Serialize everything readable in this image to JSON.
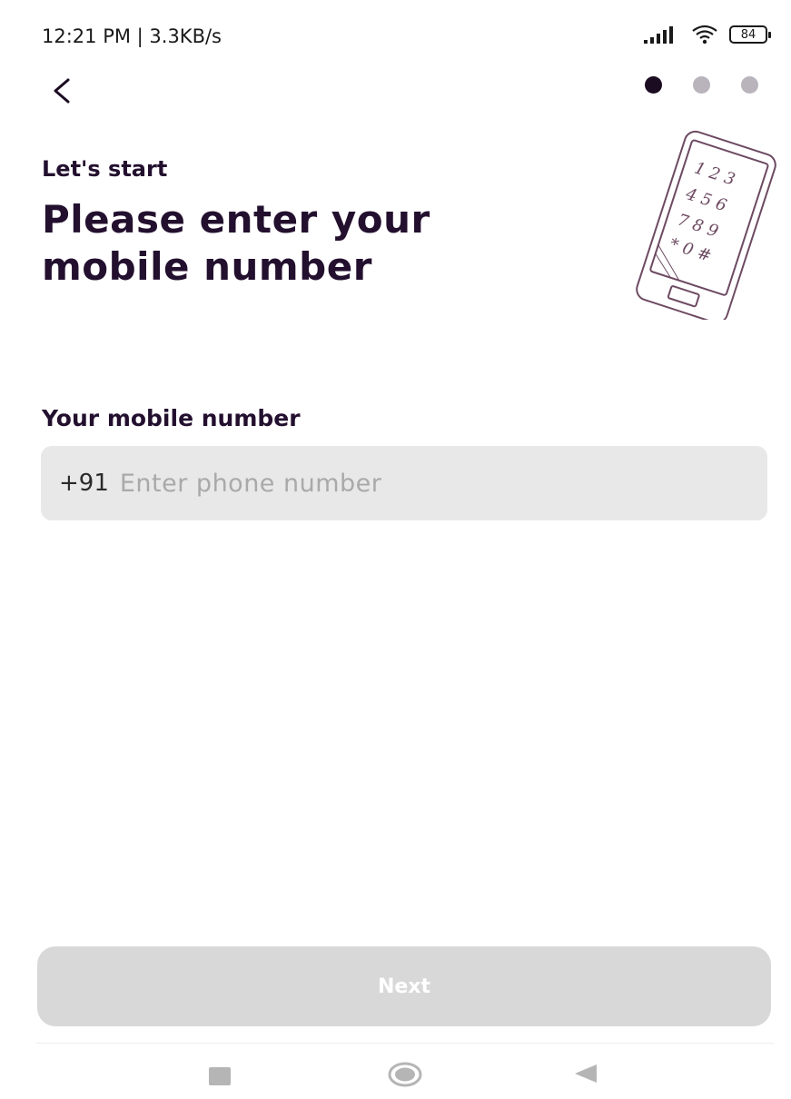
{
  "status_bar": {
    "time_speed": "12:21 PM | 3.3KB/s",
    "battery_level": "84"
  },
  "nav": {
    "steps_total": 3,
    "active_step": 1
  },
  "content": {
    "subtitle": "Let's start",
    "title": "Please enter your mobile number",
    "field_label": "Your mobile number",
    "country_code": "+91",
    "phone_placeholder": "Enter phone number",
    "phone_value": ""
  },
  "actions": {
    "next_label": "Next"
  },
  "colors": {
    "primary_text": "#230f2e",
    "dot_active": "#1c0c22",
    "dot_inactive": "#b9b4bc",
    "field_bg": "#e8e8e8",
    "button_disabled_bg": "#d8d8d8"
  }
}
